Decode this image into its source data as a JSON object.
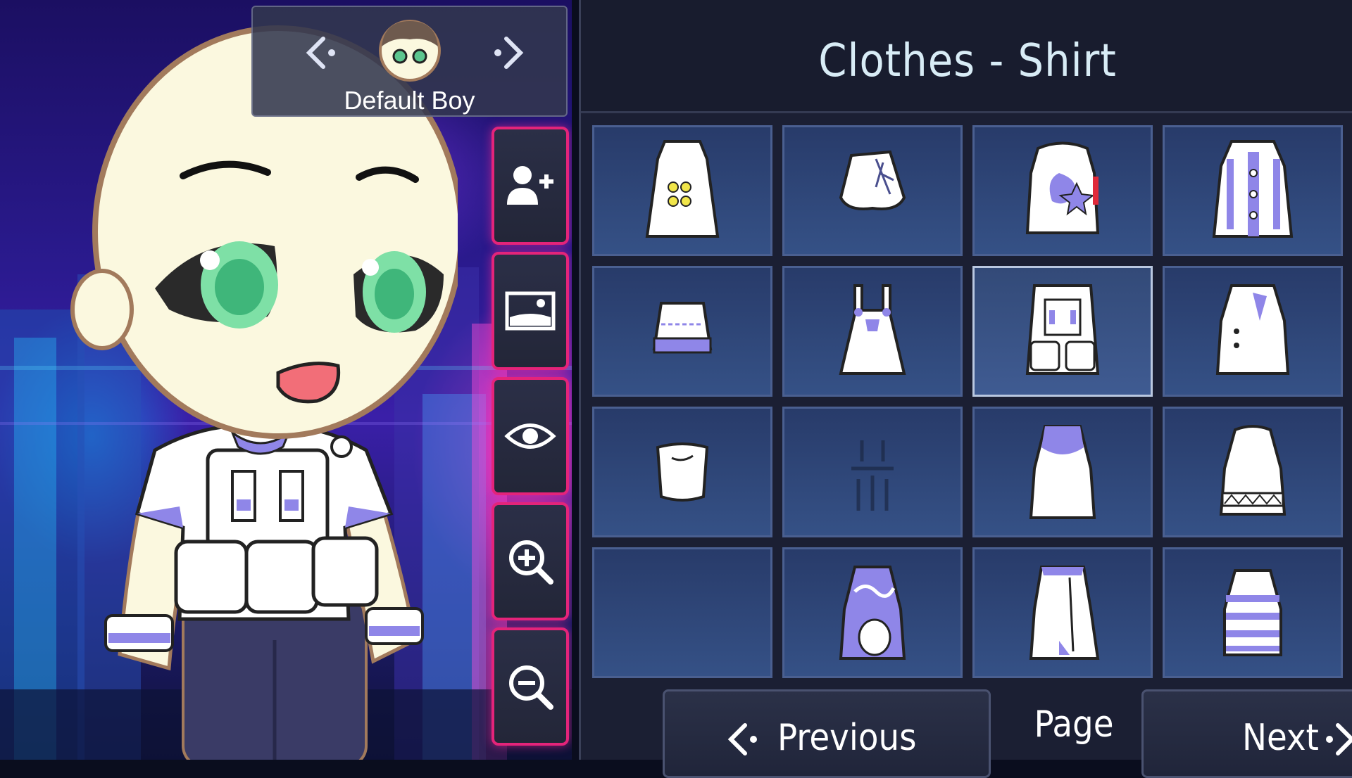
{
  "character_selector": {
    "name": "Default Boy",
    "prev_icon": "chevron-left-icon",
    "next_icon": "chevron-right-icon",
    "avatar_icon": "character-head-icon"
  },
  "tools": [
    {
      "name": "add-character",
      "icon": "add-user-icon"
    },
    {
      "name": "background",
      "icon": "image-icon"
    },
    {
      "name": "visibility",
      "icon": "eye-icon"
    },
    {
      "name": "zoom-in",
      "icon": "zoom-in-icon"
    },
    {
      "name": "zoom-out",
      "icon": "zoom-out-icon"
    }
  ],
  "panel": {
    "title": "Clothes - Shirt",
    "items": [
      {
        "id": "shirt-1",
        "icon": "white-top-yellow-buttons"
      },
      {
        "id": "shirt-2",
        "icon": "laced-crop-top"
      },
      {
        "id": "shirt-3",
        "icon": "tee-with-star-print"
      },
      {
        "id": "shirt-4",
        "icon": "button-coat"
      },
      {
        "id": "shirt-5",
        "icon": "frilled-crop-top"
      },
      {
        "id": "shirt-6",
        "icon": "overall-bib"
      },
      {
        "id": "shirt-7",
        "icon": "tactical-vest",
        "selected": true
      },
      {
        "id": "shirt-8",
        "icon": "collared-blazer"
      },
      {
        "id": "shirt-9",
        "icon": "tube-top"
      },
      {
        "id": "shirt-10",
        "icon": "abs-outline"
      },
      {
        "id": "shirt-11",
        "icon": "halter-top"
      },
      {
        "id": "shirt-12",
        "icon": "patterned-hem-top"
      },
      {
        "id": "shirt-13",
        "icon": "empty"
      },
      {
        "id": "shirt-14",
        "icon": "swirl-print-top"
      },
      {
        "id": "shirt-15",
        "icon": "asymmetric-top"
      },
      {
        "id": "shirt-16",
        "icon": "striped-tank"
      }
    ],
    "prev_label": "Previous",
    "page_label": "Page",
    "next_label": "Next"
  },
  "colors": {
    "accent": "#e4247a",
    "lavender": "#8f86e8",
    "panel_bg": "#1b1f33",
    "tile_bg": "#2f4678"
  }
}
